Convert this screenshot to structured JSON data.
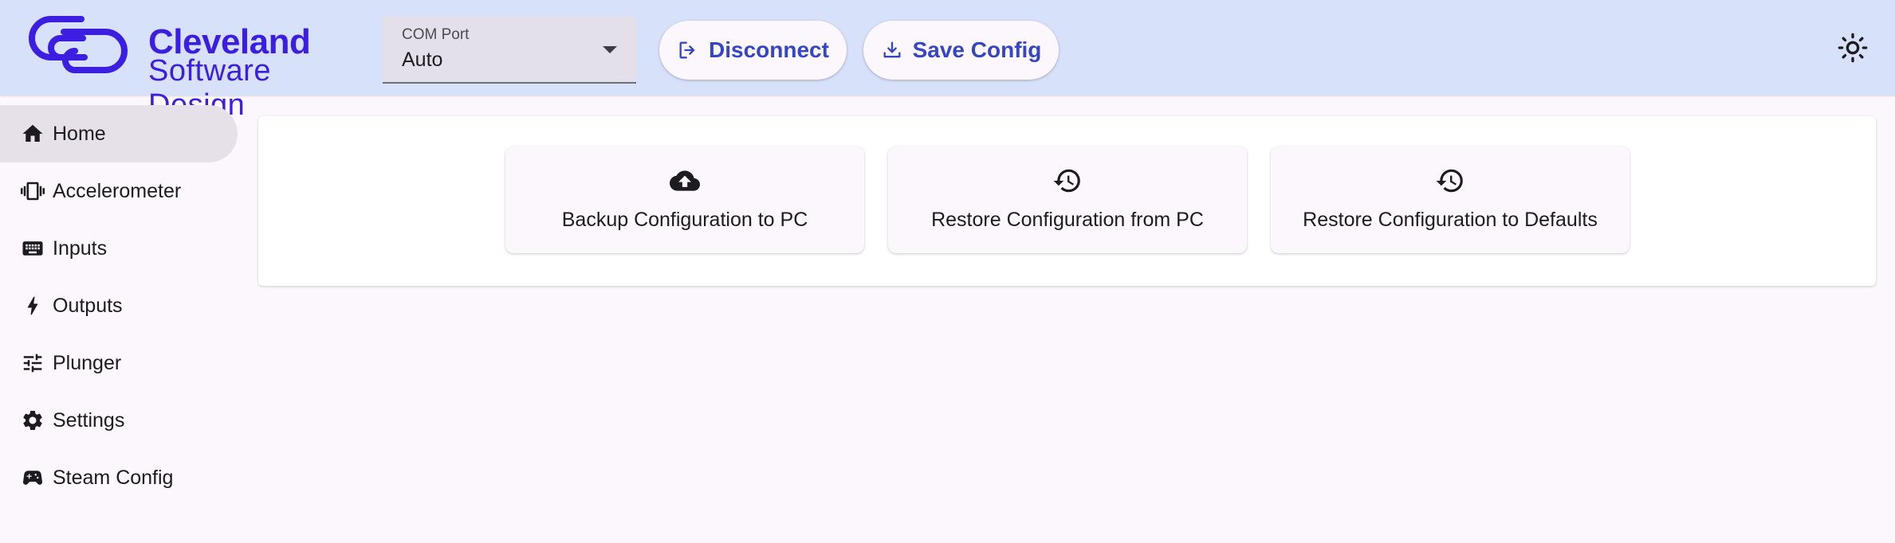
{
  "brand": {
    "line1": "Cleveland",
    "line2": "Software Design",
    "color": "#3b1ee0"
  },
  "com_port": {
    "label": "COM Port",
    "value": "Auto"
  },
  "toolbar": {
    "disconnect_label": "Disconnect",
    "save_label": "Save Config"
  },
  "sidebar": {
    "items": [
      {
        "label": "Home",
        "icon": "home-icon",
        "active": true
      },
      {
        "label": "Accelerometer",
        "icon": "vibration-icon",
        "active": false
      },
      {
        "label": "Inputs",
        "icon": "keyboard-icon",
        "active": false
      },
      {
        "label": "Outputs",
        "icon": "bolt-icon",
        "active": false
      },
      {
        "label": "Plunger",
        "icon": "tune-icon",
        "active": false
      },
      {
        "label": "Settings",
        "icon": "gear-icon",
        "active": false
      },
      {
        "label": "Steam Config",
        "icon": "gamepad-icon",
        "active": false
      }
    ]
  },
  "actions": [
    {
      "label": "Backup Configuration to PC",
      "icon": "cloud-upload-icon"
    },
    {
      "label": "Restore Configuration from PC",
      "icon": "history-icon"
    },
    {
      "label": "Restore Configuration to Defaults",
      "icon": "history-icon"
    }
  ],
  "colors": {
    "header_bg": "#d7e1fa",
    "accent": "#3446c4",
    "page_bg": "#fcf7fc"
  }
}
